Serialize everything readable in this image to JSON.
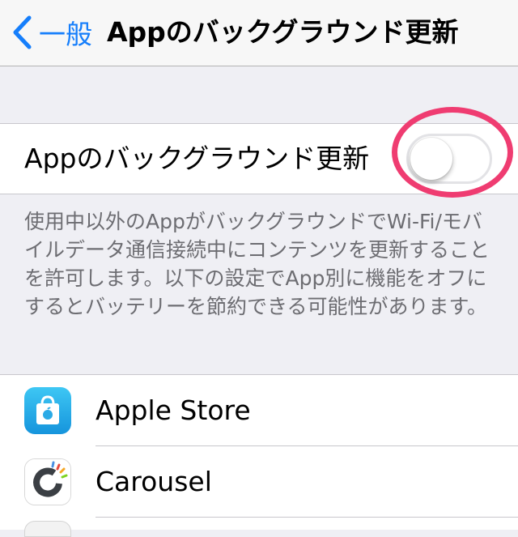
{
  "navbar": {
    "back_label": "一般",
    "back_icon": "chevron-left-icon",
    "title": "Appのバックグラウンド更新",
    "accent": "#157efb"
  },
  "setting": {
    "label": "Appのバックグラウンド更新",
    "toggle_on": false,
    "highlight_color": "#ef3c71"
  },
  "footer_text": "使用中以外のAppがバックグラウンドでWi-Fi/モバイルデータ通信接続中にコンテンツを更新することを許可します。以下の設定でApp別に機能をオフにするとバッテリーを節約できる可能性があります。",
  "apps": [
    {
      "name": "Apple Store",
      "icon": "apple-store-icon"
    },
    {
      "name": "Carousel",
      "icon": "carousel-icon"
    }
  ]
}
